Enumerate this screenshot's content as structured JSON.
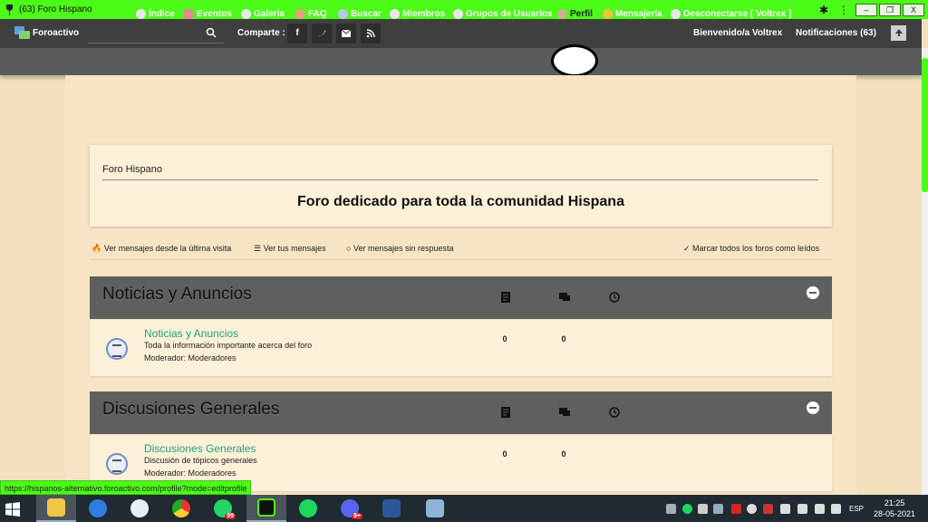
{
  "browser": {
    "window_title": "(63) Foro Hispano",
    "window_buttons": {
      "minimize": "–",
      "restore": "❐",
      "close": "X"
    }
  },
  "topbar": {
    "logo_text": "Foroactivo",
    "share_label": "Comparte :",
    "share_buttons": [
      "f",
      "t",
      "✉",
      "rss"
    ],
    "welcome": "Bienvenido/a Voltrex",
    "notifications": "Notificaciones",
    "notifications_count": "(63)"
  },
  "nav": {
    "items": [
      {
        "label": "Índice"
      },
      {
        "label": "Eventos"
      },
      {
        "label": "Galería"
      },
      {
        "label": "FAQ"
      },
      {
        "label": "Buscar"
      },
      {
        "label": "Miembros"
      },
      {
        "label": "Grupos de Usuarios"
      },
      {
        "label": "Perfil"
      },
      {
        "label": "Mensajería"
      },
      {
        "label": "Desconectarse [ Voltrex ]"
      }
    ]
  },
  "header": {
    "site_name": "Foro Hispano",
    "description": "Foro dedicado para toda la comunidad Hispana"
  },
  "quick_links": {
    "new_messages": "Ver mensajes desde la última visita",
    "your_messages": "Ver tus mensajes",
    "unanswered": "Ver mensajes sin respuesta",
    "mark_read": "Marcar todos los foros como leídos"
  },
  "categories": [
    {
      "title": "Noticias y Anuncios",
      "forum": {
        "name": "Noticias y Anuncios",
        "description": "Toda la información importante acerca del foro",
        "moderator": "Moderador: Moderadores",
        "topics": "0",
        "posts": "0"
      }
    },
    {
      "title": "Discusiones Generales",
      "forum": {
        "name": "Discusiones Generales",
        "description": "Discusión de tópicos generales",
        "moderator": "Moderador: Moderadores",
        "topics": "0",
        "posts": "0"
      }
    }
  ],
  "status_url": "https://hispanos-alternativo.foroactivo.com/profile?mode=editprofile",
  "taskbar": {
    "whatsapp_badge": "99",
    "discord_badge": "9+",
    "language": "ESP",
    "time": "21:25",
    "date": "28-05-2021"
  },
  "colors": {
    "browser_accent": "#4cfb17",
    "topbar": "#3f3f3f",
    "navbar": "#5b5b5b",
    "forum_link": "#1fa37a",
    "page_bg": "#f1dfbe"
  }
}
